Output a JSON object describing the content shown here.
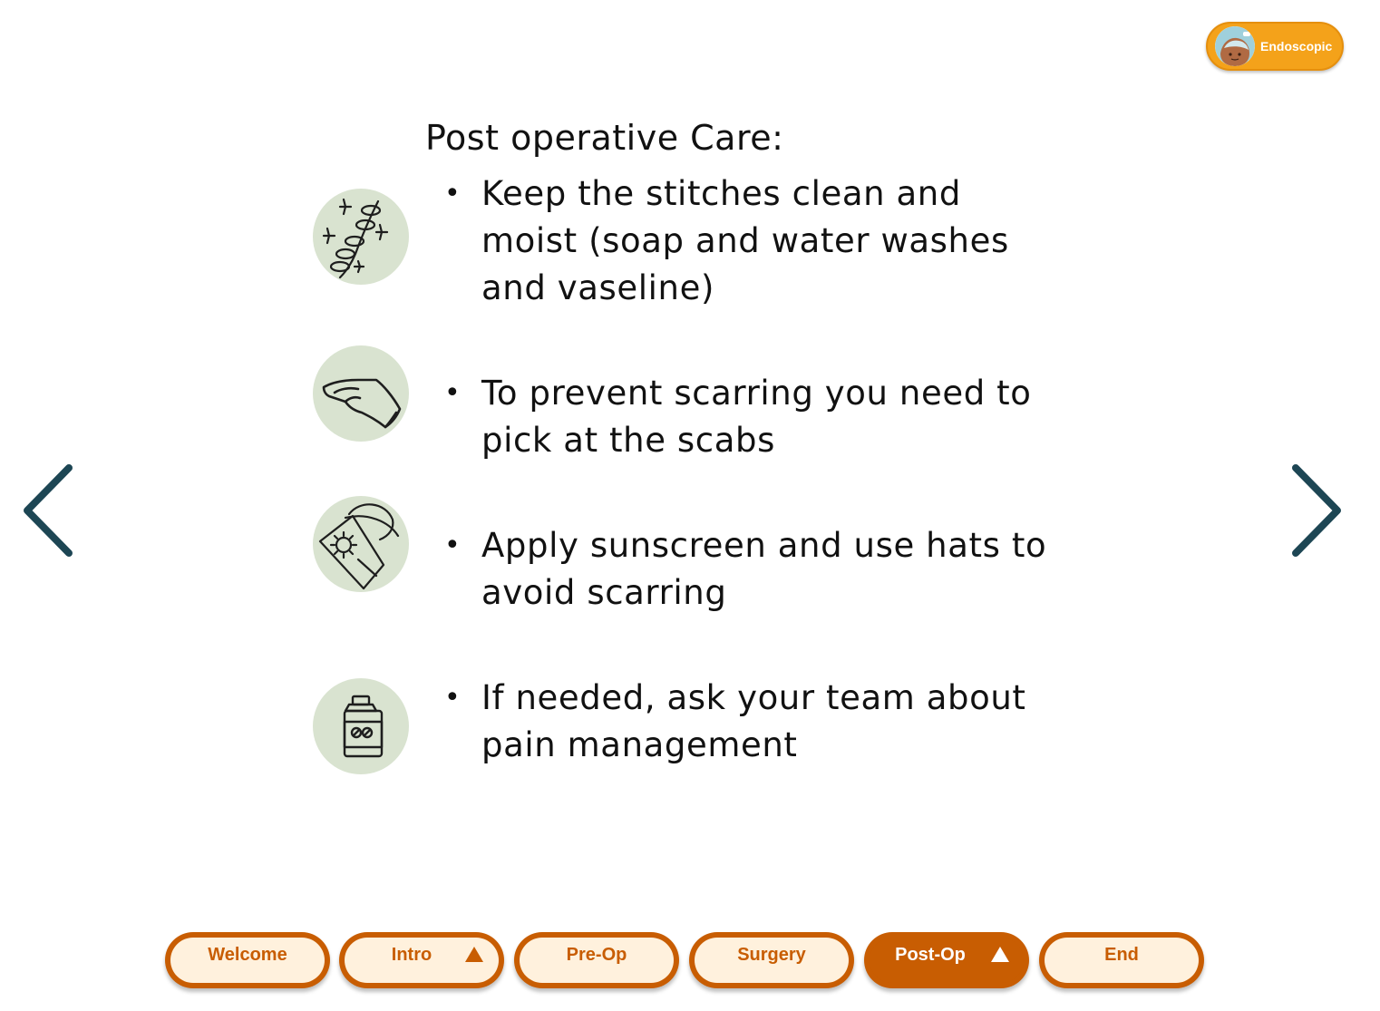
{
  "badge": {
    "label": "Endoscopic",
    "color": "#f4a21a",
    "icon": "patient-avatar-icon"
  },
  "navigation": {
    "prev_icon": "chevron-left-icon",
    "next_icon": "chevron-right-icon",
    "arrow_color": "#1d4654"
  },
  "content": {
    "title": "Post operative Care:",
    "bullet": "•",
    "items": [
      {
        "text": "Keep the stitches clean and moist (soap and water washes and vaseline)",
        "icon": "stitches-icon"
      },
      {
        "text": "To prevent scarring you need to pick at the scabs",
        "icon": "hand-icon"
      },
      {
        "text": "Apply sunscreen and use hats to avoid scarring",
        "icon": "sunscreen-hat-icon"
      },
      {
        "text": "If needed, ask your team about pain management",
        "icon": "pill-bottle-icon"
      }
    ],
    "icon_background": "#d9e3d0"
  },
  "bottom_nav": {
    "accent": "#c85d02",
    "inactive_fill": "#fff1dd",
    "tabs": [
      {
        "label": "Welcome",
        "active": false,
        "has_caret": false
      },
      {
        "label": "Intro",
        "active": false,
        "has_caret": true
      },
      {
        "label": "Pre-Op",
        "active": false,
        "has_caret": false
      },
      {
        "label": "Surgery",
        "active": false,
        "has_caret": false
      },
      {
        "label": "Post-Op",
        "active": true,
        "has_caret": true
      },
      {
        "label": "End",
        "active": false,
        "has_caret": false
      }
    ]
  }
}
